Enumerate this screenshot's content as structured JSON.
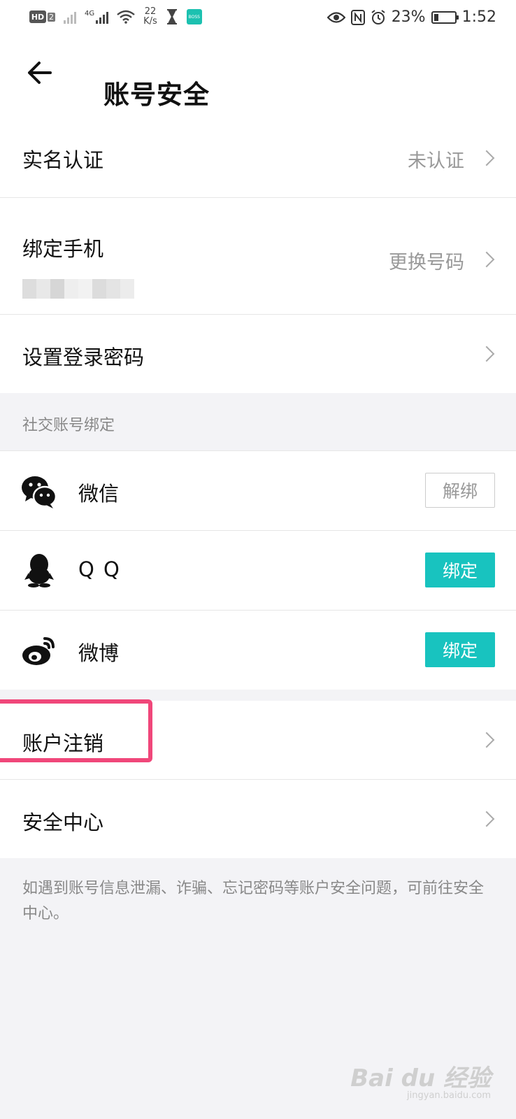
{
  "status_bar": {
    "net_speed_value": "22",
    "net_speed_unit": "K/s",
    "hd_label": "HD",
    "hd_sim": "2",
    "net_type": "4G",
    "boss_icon_text": "BOSS",
    "battery_percent": "23%",
    "time": "1:52",
    "battery_level": 0.23
  },
  "header": {
    "title": "账号安全"
  },
  "account": {
    "real_name": {
      "label": "实名认证",
      "value": "未认证"
    },
    "phone": {
      "label": "绑定手机",
      "value": "更换号码"
    },
    "password": {
      "label": "设置登录密码"
    }
  },
  "social": {
    "section_title": "社交账号绑定",
    "items": [
      {
        "label": "微信",
        "icon": "wechat-icon",
        "button": "解绑",
        "state": "bound"
      },
      {
        "label": "Q Q",
        "icon": "qq-icon",
        "button": "绑定",
        "state": "unbound"
      },
      {
        "label": "微博",
        "icon": "weibo-icon",
        "button": "绑定",
        "state": "unbound"
      }
    ]
  },
  "other": {
    "deactivate": {
      "label": "账户注销"
    },
    "security_center": {
      "label": "安全中心"
    }
  },
  "footer_note": "如遇到账号信息泄漏、诈骗、忘记密码等账户安全问题，可前往安全中心。",
  "watermark": {
    "main": "Bai du 经验",
    "sub": "jingyan.baidu.com"
  },
  "colors": {
    "accent": "#18c3bf",
    "highlight": "#f0477a"
  }
}
